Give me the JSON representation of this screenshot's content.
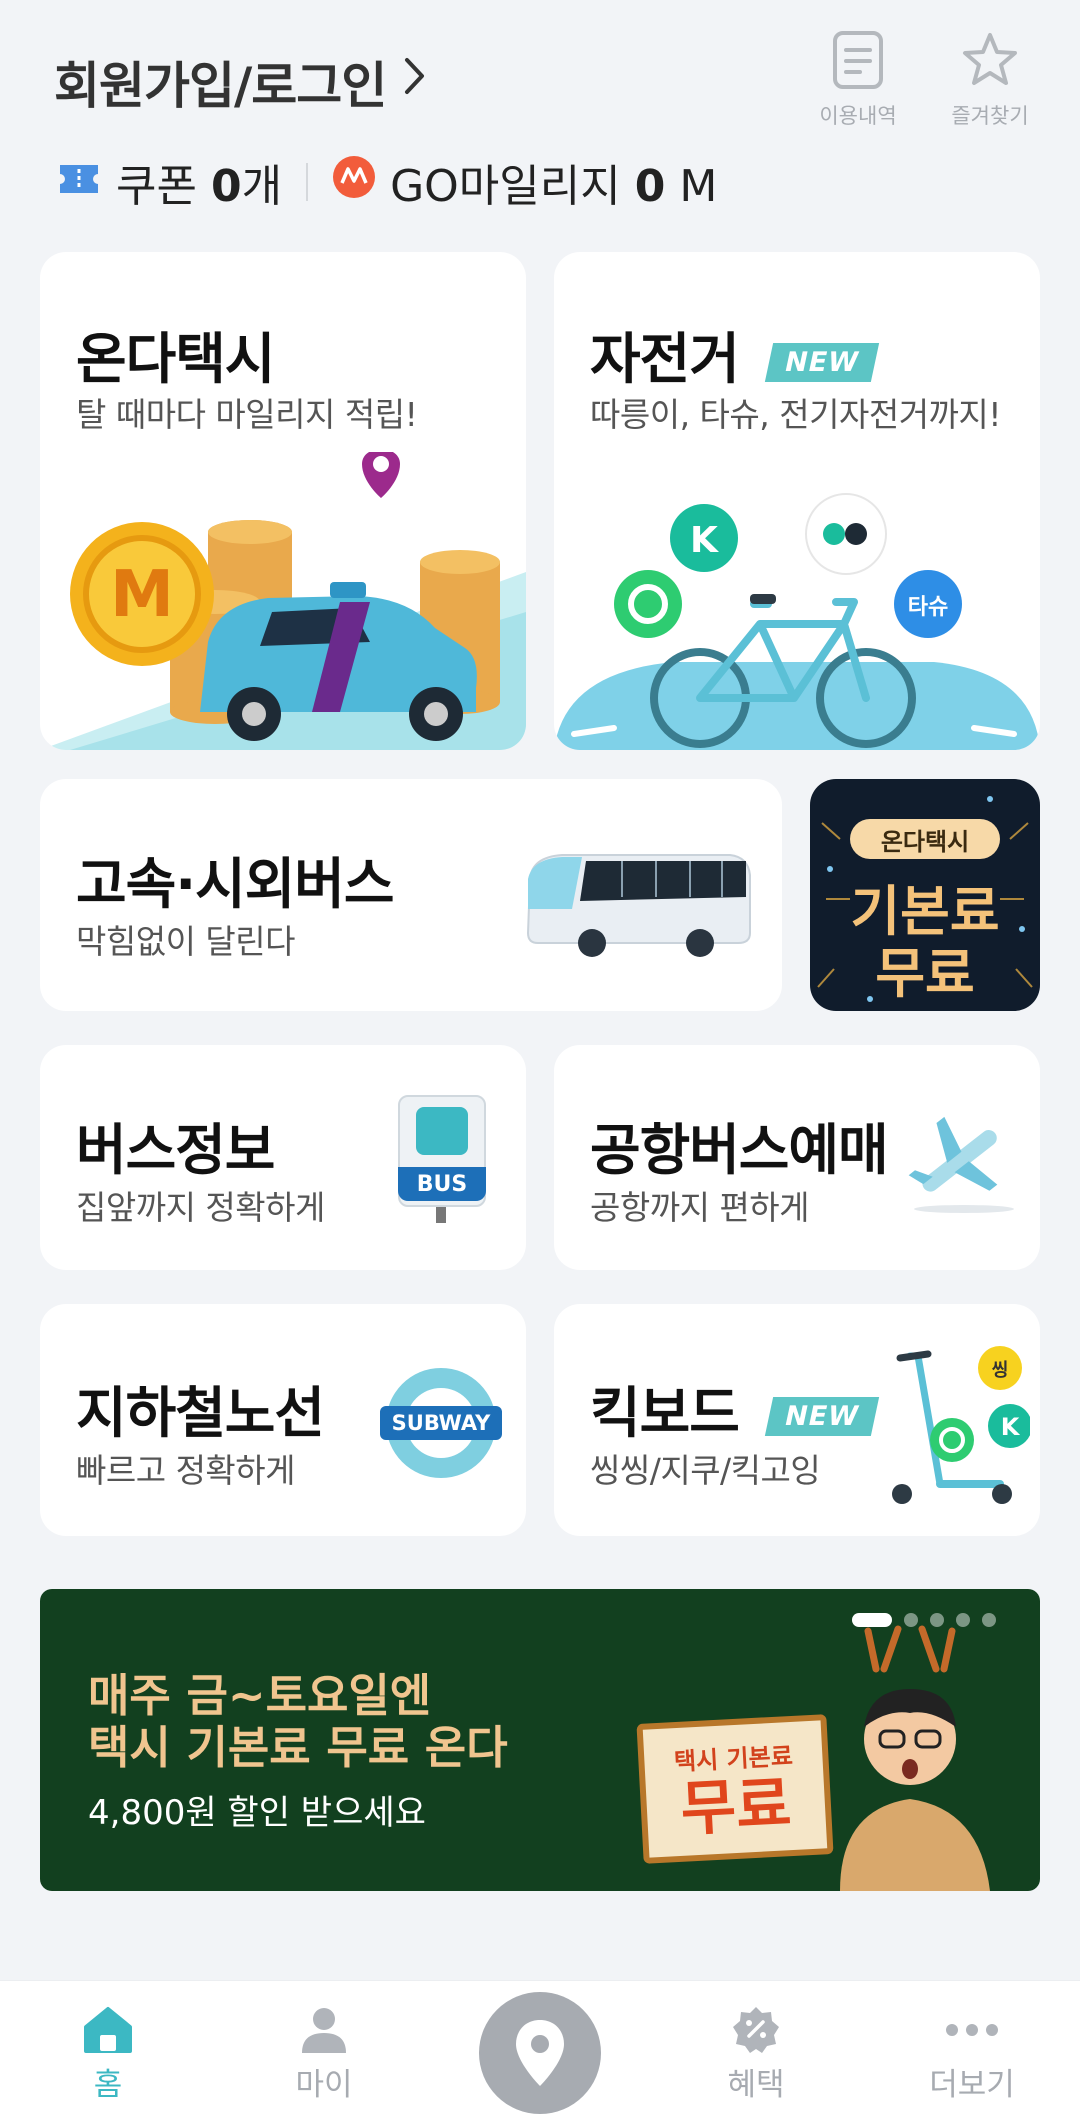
{
  "header": {
    "login_label": "회원가입/로그인",
    "history_label": "이용내역",
    "favorites_label": "즐겨찾기"
  },
  "wallet": {
    "coupon_label": "쿠폰",
    "coupon_count": "0",
    "coupon_unit": "개",
    "mileage_label": "GO마일리지",
    "mileage_value": "0",
    "mileage_unit": "M"
  },
  "services": {
    "taxi": {
      "title": "온다택시",
      "subtitle": "탈 때마다 마일리지 적립!"
    },
    "bike": {
      "title": "자전거",
      "badge": "NEW",
      "subtitle": "따릉이, 타슈, 전기자전거까지!",
      "tashu_label": "타슈"
    },
    "express_bus": {
      "title": "고속·시외버스",
      "subtitle": "막힘없이 달린다"
    },
    "promo_tile": {
      "tag": "온다택시",
      "line1": "기본료",
      "line2": "무료"
    },
    "bus_info": {
      "title": "버스정보",
      "subtitle": "집앞까지 정확하게",
      "sign_text": "BUS"
    },
    "airport_bus": {
      "title": "공항버스예매",
      "subtitle": "공항까지 편하게"
    },
    "subway": {
      "title": "지하철노선",
      "subtitle": "빠르고 정확하게",
      "sign_text": "SUBWAY"
    },
    "kickboard": {
      "title": "킥보드",
      "badge": "NEW",
      "subtitle": "씽씽/지쿠/킥고잉",
      "ssing_label": "씽"
    }
  },
  "banner": {
    "line1": "매주 금~토요일엔",
    "line2": "택시 기본료 무료 온다",
    "line3": "4,800원 할인 받으세요",
    "sign_top": "택시 기본료",
    "sign_main": "무료",
    "slide_count": 5,
    "active_slide": 1
  },
  "bottom_nav": {
    "home": "홈",
    "my": "마이",
    "benefits": "혜택",
    "more": "더보기"
  },
  "colors": {
    "accent": "#3cb8c3",
    "new_badge": "#5cc5c5",
    "banner_bg": "#12401f",
    "banner_text": "#f0c58f"
  }
}
